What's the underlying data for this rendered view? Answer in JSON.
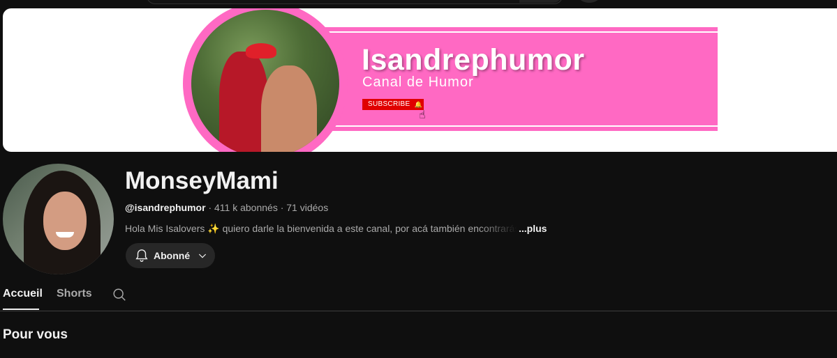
{
  "banner": {
    "title": "Isandrephumor",
    "subtitle": "Canal de Humor",
    "subscribe_label": "SUBSCRIBE",
    "brand_color": "#ff69c3"
  },
  "channel": {
    "name": "MonseyMami",
    "handle": "@isandrephumor",
    "stats": " · 411 k abonnés · 71 vidéos",
    "description": "Hola Mis Isalovers ✨ quiero darle la bienvenida a este canal, por acá también encontrarás",
    "more_label": "...plus",
    "subscribed_label": "Abonné"
  },
  "tabs": [
    {
      "label": "Accueil",
      "active": true
    },
    {
      "label": "Shorts",
      "active": false
    }
  ],
  "section": {
    "title": "Pour vous"
  }
}
